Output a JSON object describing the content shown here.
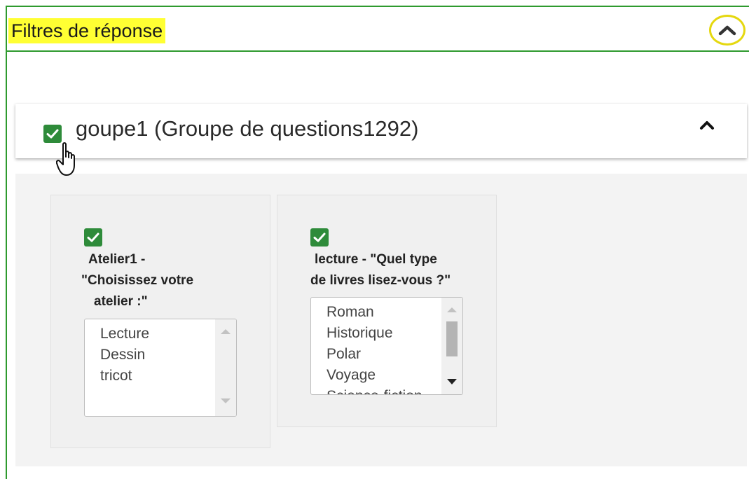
{
  "header": {
    "title": "Filtres de réponse",
    "highlight_color": "#ffff33",
    "border_color": "#2e9a2e",
    "collapse_icon": "chevron-up-circle-icon"
  },
  "group": {
    "checked": true,
    "label": "goupe1 (Groupe de questions1292)",
    "toggle_icon": "chevron-up-icon"
  },
  "questions": [
    {
      "checked": true,
      "label_lines": [
        "Atelier1 -",
        "\"Choisissez votre",
        "atelier :\""
      ],
      "options": [
        "Lecture",
        "Dessin",
        "tricot"
      ]
    },
    {
      "checked": true,
      "label_lines": [
        "lecture - \"Quel type",
        "de livres lisez-vous ?\""
      ],
      "options": [
        "Roman",
        "Historique",
        "Polar",
        "Voyage",
        "Science-fiction"
      ]
    }
  ]
}
